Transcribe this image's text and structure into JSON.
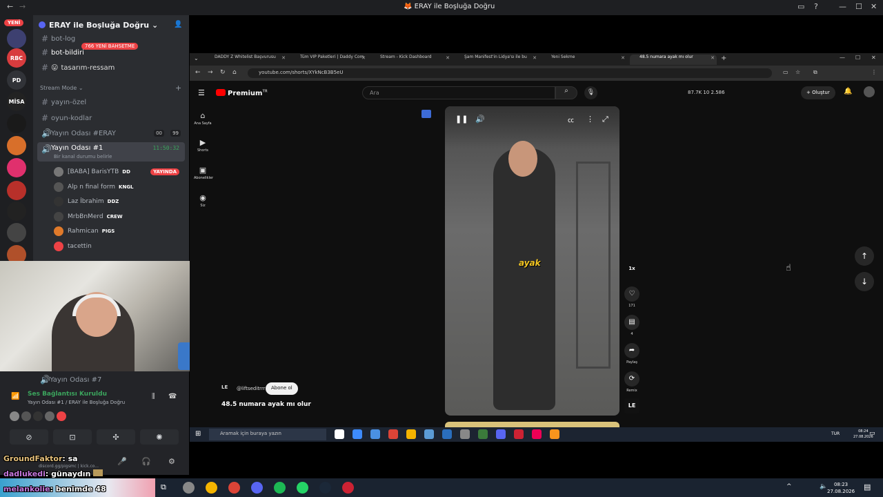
{
  "window": {
    "title": "ERAY ile Boşluğa Doğru"
  },
  "rail": {
    "new_label": "YENİ",
    "servers": [
      {
        "label": "",
        "count": "1",
        "color": "#3d4070"
      },
      {
        "label": "RBC",
        "count": "",
        "color": "#d83c3e"
      },
      {
        "label": "PD",
        "count": "",
        "color": "#313338"
      },
      {
        "label": "MİSA",
        "count": "",
        "color": "#222"
      },
      {
        "label": "",
        "count": "1",
        "color": "#1a1a1a"
      },
      {
        "label": "",
        "count": "766",
        "color": "#d86f2a"
      },
      {
        "label": "",
        "count": "1",
        "color": "#e0306d"
      },
      {
        "label": "",
        "count": "166",
        "color": "#b8302a"
      },
      {
        "label": "",
        "count": "78",
        "color": "#222"
      },
      {
        "label": "",
        "count": "230",
        "color": "#444"
      },
      {
        "label": "",
        "count": "",
        "color": "#b0502a"
      }
    ]
  },
  "sidebar": {
    "server_name": "ERAY ile Boşluğa Doğru",
    "new_bet_badge": "766 YENİ BAHSETME",
    "channels_top": [
      "bot-log",
      "bot-bildiri",
      "tasarım-ressam"
    ],
    "category": "Stream Mode",
    "channels": [
      {
        "name": "yayın-özel",
        "type": "text"
      },
      {
        "name": "oyun-kodlar",
        "type": "text"
      },
      {
        "name": "Yayın Odası #ERAY",
        "type": "voice",
        "pill1": "00",
        "pill2": "99"
      },
      {
        "name": "Yayın Odası #1",
        "type": "voice",
        "time": "11:50:32",
        "status": "Bir kanal durumu belirle"
      }
    ],
    "voice_users": [
      {
        "name": "[BABA] BarisYTB",
        "tag": "DD",
        "live": "YAYINDA",
        "color": "#777"
      },
      {
        "name": "Alp n final form",
        "tag": "KNGL",
        "live": "",
        "color": "#555"
      },
      {
        "name": "Laz İbrahim",
        "tag": "DDZ",
        "live": "",
        "color": "#333"
      },
      {
        "name": "MrbBnMerd",
        "tag": "CREW",
        "live": "",
        "color": "#444"
      },
      {
        "name": "Rahmican",
        "tag": "PIGS",
        "live": "",
        "color": "#e07a2a"
      },
      {
        "name": "tacettin",
        "tag": "",
        "live": "",
        "color": "#ed4245"
      }
    ],
    "channel_bottom": "Yayın Odası #7"
  },
  "voice": {
    "title": "Ses Bağlantısı Kuruldu",
    "subtitle": "Yayın Odası #1 / ERAY ile Boşluğa Doğru"
  },
  "chat": [
    {
      "user": "GroundFaktor",
      "text": ": sa"
    },
    {
      "user": "dadlukedi",
      "text": ": günaydın"
    },
    {
      "user": "melankolie",
      "text": ": benimde 48"
    }
  ],
  "user_panel": {
    "status": "discord.gg/pigsmc | kick.co..."
  },
  "browser": {
    "tabs": [
      {
        "label": "DADDY Z Whitelist Başvurusu",
        "active": false
      },
      {
        "label": "Tüm VIP Paketleri | Daddy Com",
        "active": false
      },
      {
        "label": "Stream - Kick Dashboard",
        "active": false
      },
      {
        "label": "Şam Manifest'in Lidya'sı ile bu",
        "active": false
      },
      {
        "label": "Yeni Sekme",
        "active": false
      },
      {
        "label": "48.5 numara ayak mı olur",
        "active": true
      }
    ],
    "url": "youtube.com/shorts/XYkNcB3B5eU"
  },
  "youtube": {
    "logo": "Premium",
    "logo_sup": "TR",
    "search_placeholder": "Ara",
    "stats": "87.7K  10  2.586",
    "create": "Oluştur",
    "guide": [
      {
        "label": "Ana Sayfa",
        "icon": "home-icon"
      },
      {
        "label": "Shorts",
        "icon": "shorts-icon"
      },
      {
        "label": "Abonelikler",
        "icon": "subscriptions-icon"
      },
      {
        "label": "Siz",
        "icon": "you-icon"
      }
    ],
    "short": {
      "caption": "ayak",
      "channel": "@liftseditrrr",
      "subscribe": "Abone ol",
      "title": "48.5 numara ayak mı olur",
      "speed": "1x",
      "likes": "171",
      "comments": "4",
      "share": "Paylaş",
      "remix": "Remix"
    }
  },
  "inner_taskbar": {
    "search": "Aramak için buraya yazın",
    "lang": "TUR",
    "time": "08:24",
    "date": "27.08.2026"
  },
  "taskbar": {
    "time": "08:23",
    "date": "27.08.2026"
  }
}
